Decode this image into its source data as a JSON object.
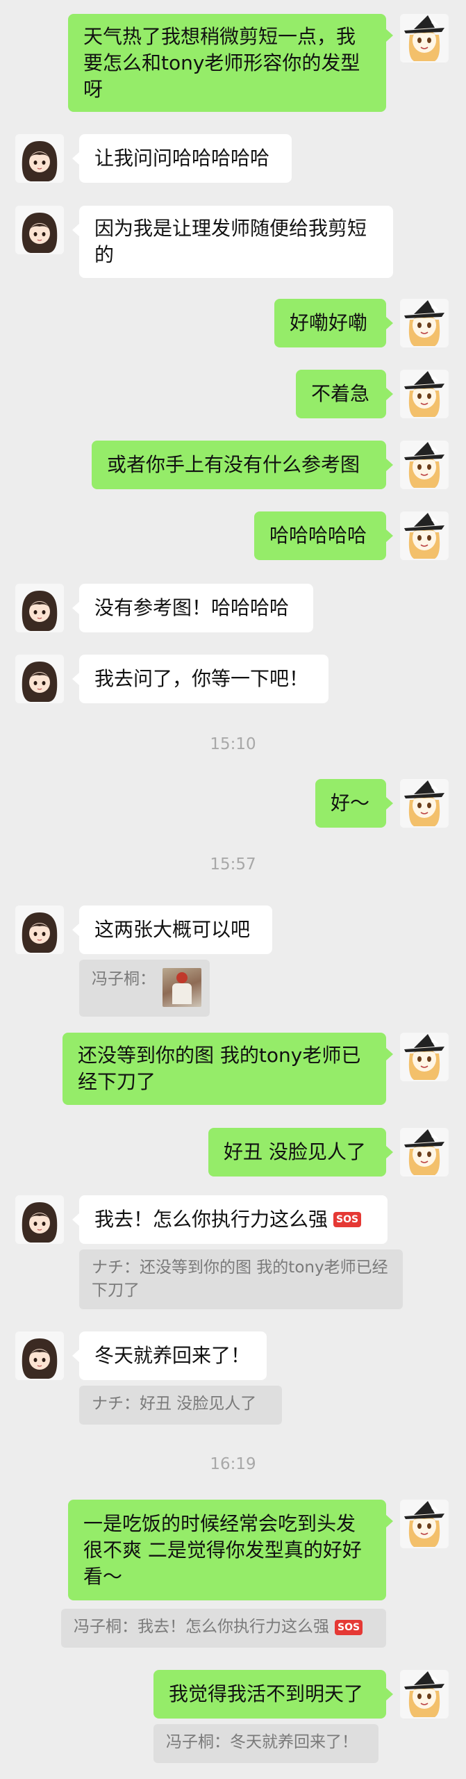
{
  "avatars": {
    "me": {
      "hair": "#f3c06b",
      "hat": "#222222",
      "face": "#fff6e6"
    },
    "them": {
      "hair": "#3b2a22",
      "face": "#fbe3d2"
    }
  },
  "messages": [
    {
      "side": "out",
      "text": "天气热了我想稍微剪短一点，我要怎么和tony老师形容你的发型呀"
    },
    {
      "side": "in",
      "text": "让我问问哈哈哈哈哈"
    },
    {
      "side": "in",
      "text": "因为我是让理发师随便给我剪短的"
    },
    {
      "side": "out",
      "text": "好嘞好嘞"
    },
    {
      "side": "out",
      "text": "不着急"
    },
    {
      "side": "out",
      "text": "或者你手上有没有什么参考图"
    },
    {
      "side": "out",
      "text": "哈哈哈哈哈"
    },
    {
      "side": "in",
      "text": "没有参考图！哈哈哈哈"
    },
    {
      "side": "in",
      "text": "我去问了，你等一下吧！"
    },
    {
      "side": "out",
      "text": "好～"
    },
    {
      "side": "in",
      "text": "这两张大概可以吧"
    },
    {
      "side": "out",
      "text": "还没等到你的图 我的tony老师已经下刀了"
    },
    {
      "side": "out",
      "text": "好丑 没脸见人了"
    },
    {
      "side": "in",
      "text": "我去！怎么你执行力这么强"
    },
    {
      "side": "in",
      "text": "冬天就养回来了！"
    },
    {
      "side": "out",
      "text": "一是吃饭的时候经常会吃到头发很不爽 二是觉得你发型真的好好看～"
    },
    {
      "side": "out",
      "text": "我觉得我活不到明天了"
    }
  ],
  "times": [
    "15:10",
    "15:57",
    "16:19"
  ],
  "quotes": [
    {
      "sender": "冯子桐：",
      "text": ""
    },
    {
      "sender": "ナチ：",
      "text": "还没等到你的图 我的tony老师已经下刀了"
    },
    {
      "sender": "ナチ：",
      "text": "好丑 没脸见人了"
    },
    {
      "sender": "冯子桐：",
      "text": "我去！怎么你执行力这么强"
    },
    {
      "sender": "冯子桐：",
      "text": "冬天就养回来了！"
    }
  ],
  "sos_label": "SOS"
}
